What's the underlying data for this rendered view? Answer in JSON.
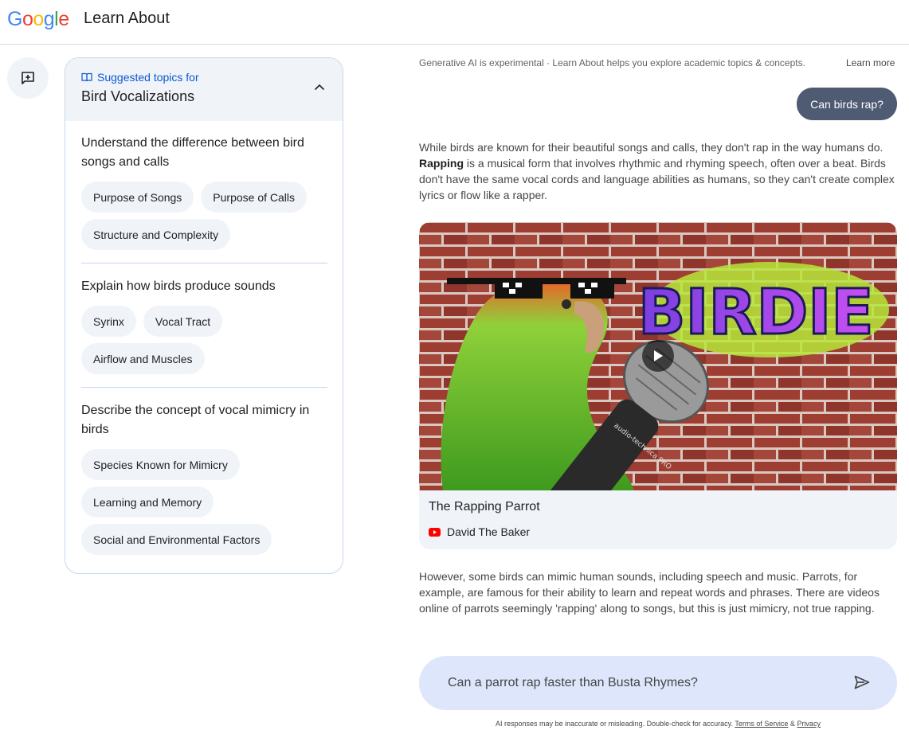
{
  "header": {
    "logo_letters": [
      {
        "ch": "G",
        "color": "#4285F4"
      },
      {
        "ch": "o",
        "color": "#EA4335"
      },
      {
        "ch": "o",
        "color": "#FBBC05"
      },
      {
        "ch": "g",
        "color": "#4285F4"
      },
      {
        "ch": "l",
        "color": "#34A853"
      },
      {
        "ch": "e",
        "color": "#EA4335"
      }
    ],
    "app_title": "Learn About"
  },
  "new_chat": {
    "icon": "add-chat-icon"
  },
  "sidebar": {
    "suggested_label": "Suggested topics for",
    "topic": "Bird Vocalizations",
    "sections": [
      {
        "title": "Understand the difference between bird songs and calls",
        "chips": [
          "Purpose of Songs",
          "Purpose of Calls",
          "Structure and Complexity"
        ]
      },
      {
        "title": "Explain how birds produce sounds",
        "chips": [
          "Syrinx",
          "Vocal Tract",
          "Airflow and Muscles"
        ]
      },
      {
        "title": "Describe the concept of vocal mimicry in birds",
        "chips": [
          "Species Known for Mimicry",
          "Learning and Memory",
          "Social and Environmental Factors"
        ]
      }
    ]
  },
  "main": {
    "disclaimer": "Generative AI is experimental · Learn About helps you explore academic topics & concepts.",
    "learn_more": "Learn more",
    "user_query": "Can birds rap?",
    "answer_p1_bold": "Rapping",
    "answer_p1_a": "While birds are known for their beautiful songs and calls, they don't rap in the way humans do. ",
    "answer_p1_b": " is a musical form that involves rhythmic and rhyming speech, often over a beat. Birds don't have the same vocal cords and language abilities as humans, so they can't create complex lyrics or flow like a rapper.",
    "video": {
      "title": "The Rapping Parrot",
      "channel": "David The Baker",
      "graffiti_text": "BIRDIE",
      "mic_brand": "audio-technica PRO"
    },
    "answer_p2": "However, some birds can mimic human sounds, including speech and music. Parrots, for example, are famous for their ability to learn and repeat words and phrases. There are videos online of parrots seemingly 'rapping' along to songs, but this is just mimicry, not true rapping."
  },
  "input": {
    "value": "Can a parrot rap faster than Busta Rhymes?",
    "send_icon": "send-icon"
  },
  "footer": {
    "note": "AI responses may be inaccurate or misleading. Double-check for accuracy.",
    "tos": "Terms of Service",
    "amp": "&",
    "privacy": "Privacy"
  },
  "colors": {
    "accent": "#0b57d0",
    "bubble": "#4f5a73",
    "input_bg": "#dde6fb",
    "chip_bg": "#f0f4f9"
  }
}
